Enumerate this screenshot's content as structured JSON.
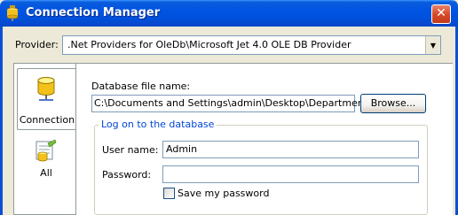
{
  "window": {
    "title": "Connection Manager",
    "close_glyph": "✕"
  },
  "provider": {
    "label": "Provider:",
    "selected": ".Net Providers for OleDb\\Microsoft Jet 4.0 OLE DB Provider"
  },
  "tabs": [
    {
      "label": "Connection",
      "icon": "database-connection-icon",
      "selected": true
    },
    {
      "label": "All",
      "icon": "all-properties-icon",
      "selected": false
    }
  ],
  "database_file": {
    "label": "Database file name:",
    "value": "C:\\Documents and Settings\\admin\\Desktop\\Departments.xls",
    "browse_label": "Browse..."
  },
  "logon": {
    "group_label": "Log on to the database",
    "username_label": "User name:",
    "username_value": "Admin",
    "password_label": "Password:",
    "password_value": "",
    "save_password_label": "Save my password",
    "save_password_checked": false
  },
  "colors": {
    "titlebar": "#0054e3",
    "group_label": "#0046d5",
    "close_button": "#d74b2a"
  }
}
